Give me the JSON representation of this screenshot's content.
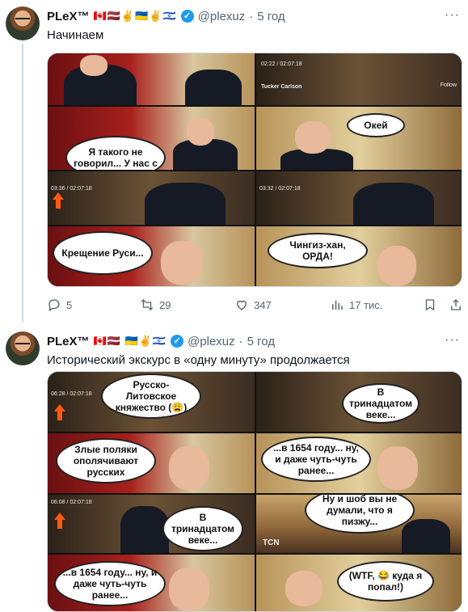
{
  "tweets": [
    {
      "author": "PLeX™",
      "flags": "🇨🇦🇱🇻✌️🇺🇦✌️🇮🇱",
      "handle": "@plexuz",
      "dot": "·",
      "time": "5 год",
      "text": "Начинаем",
      "media": {
        "bubbles": [
          "Я такого не говорил... У нас с",
          "Окей",
          "Крещение Руси...",
          "Чингиз-хан, ОРДА!"
        ],
        "overlays": [
          "02:22 / 02:07:18",
          "03:36 / 02:07:18",
          "03:32 / 02:07:18",
          "Tucker Carlson",
          "Follow"
        ]
      },
      "actions": {
        "replies": "5",
        "retweets": "29",
        "likes": "347",
        "views": "17 тис."
      }
    },
    {
      "author": "PLeX™",
      "flags": "🇨🇦🇱🇻 🇺🇦✌️🇮🇱",
      "handle": "@plexuz",
      "dot": "·",
      "time": "5 год",
      "text": "Исторический экскурс в «одну минуту» продолжается",
      "media": {
        "bubbles": [
          "Русско-Литовское княжество (😩)",
          "В тринадцатом веке...",
          "Злые поляки ополячивают русских",
          "...в 1654 году... ну, и даже чуть-чуть ранее...",
          "В тринадцатом веке...",
          "Ну и шоб вы не думали, что я пизжу...",
          "...в 1654 году... ну, и даже чуть-чуть ранее...",
          "(WTF, 😂 куда я попал!)"
        ],
        "overlays": [
          "06:28 / 02:07:18",
          "06:08 / 02:07:18",
          "TCN"
        ]
      }
    }
  ]
}
